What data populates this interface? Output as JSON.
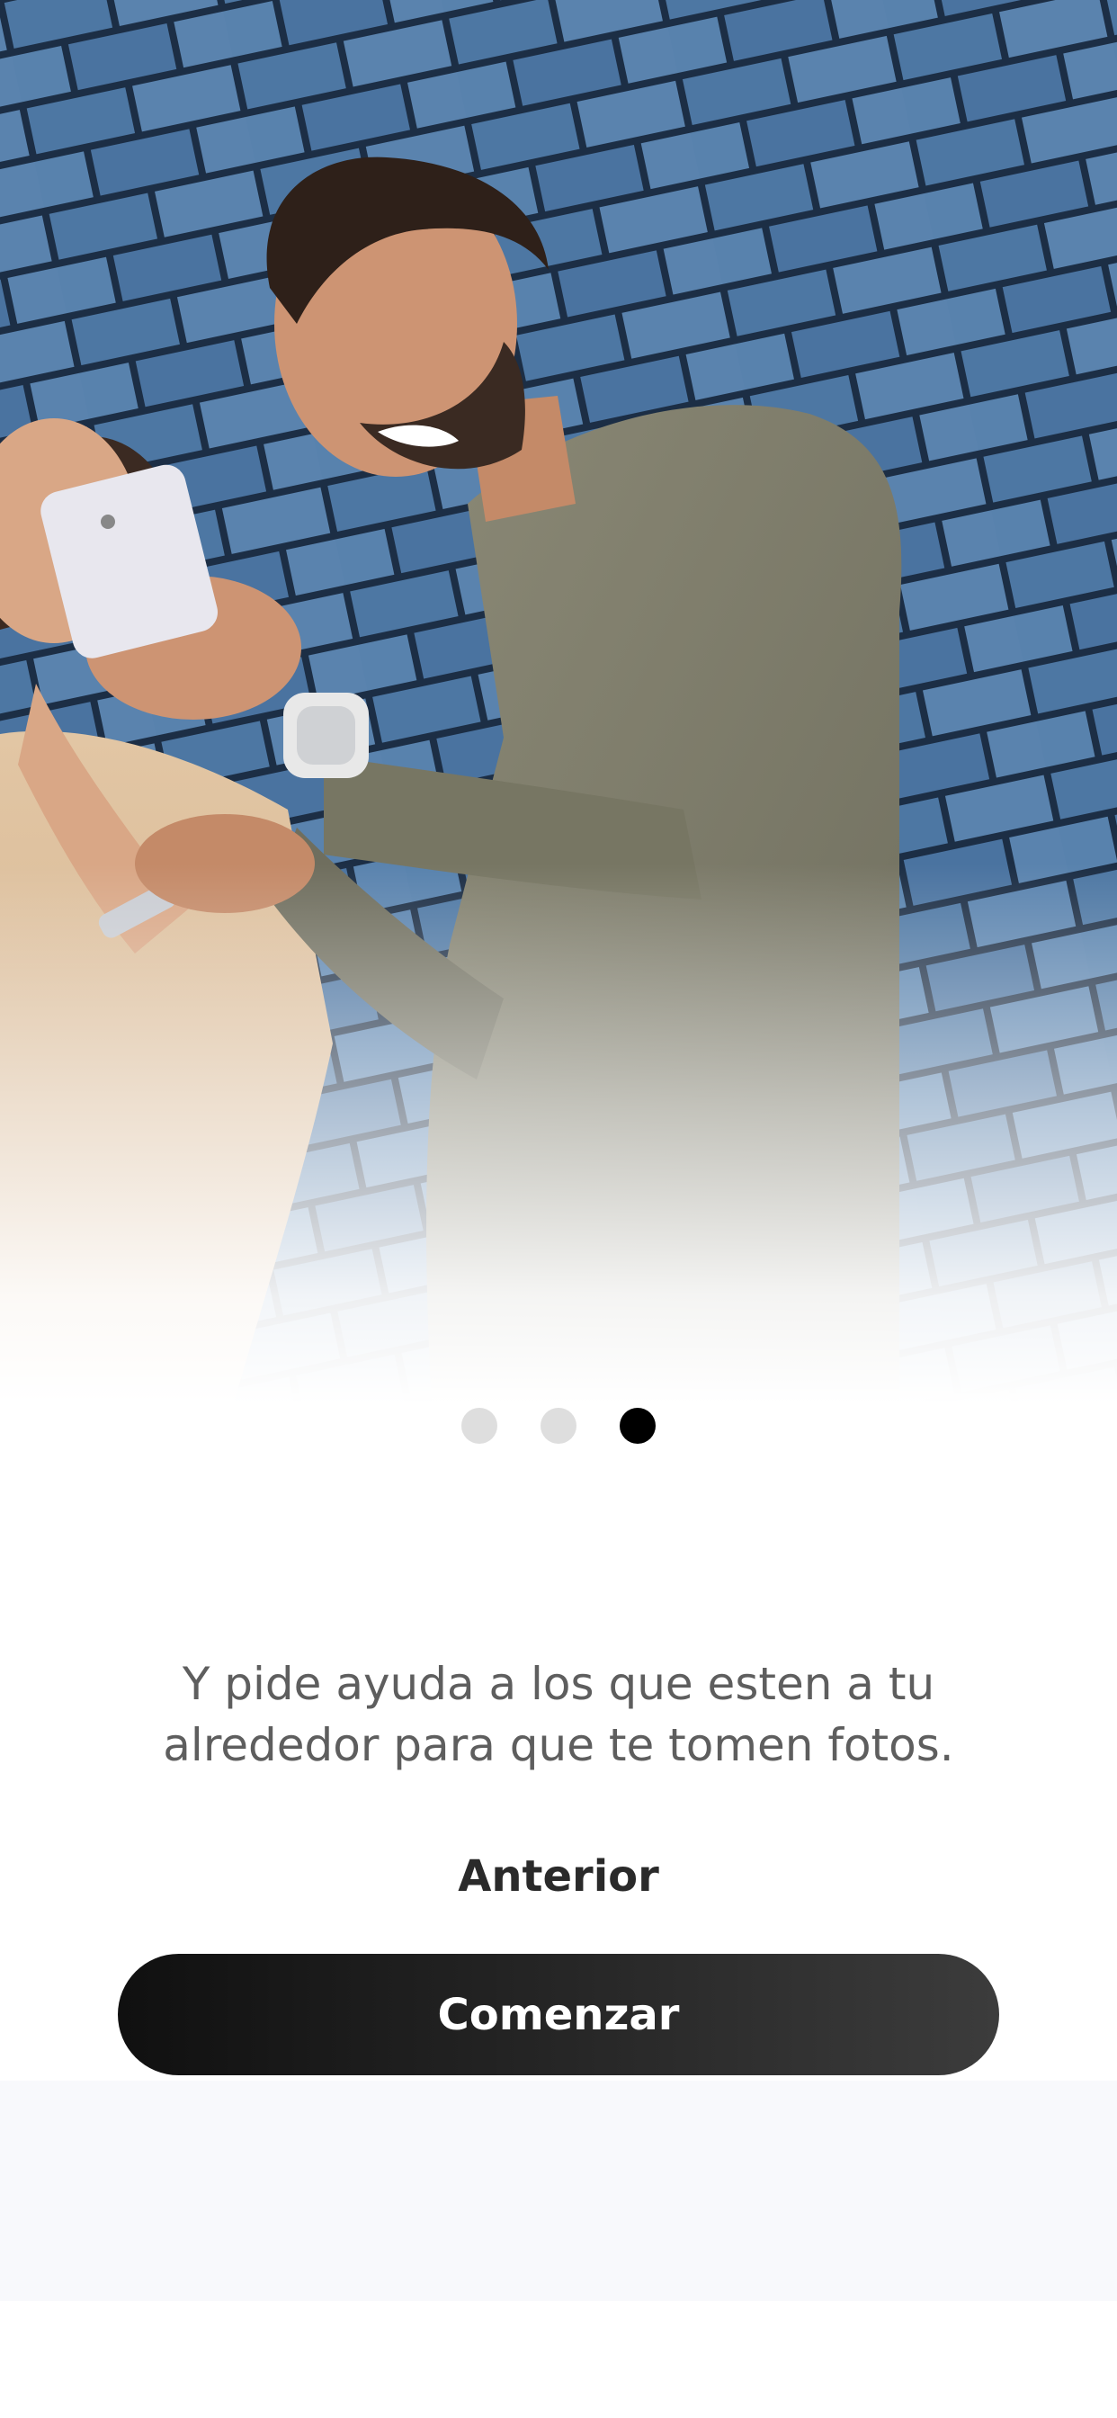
{
  "hero": {
    "image": "photo-two-friends-looking-at-phone-brick-wall",
    "wall_color": "#4d77a3",
    "mortar_color": "#1c2e45"
  },
  "pager": {
    "count": 3,
    "active_index": 2
  },
  "message": {
    "line1": "Y pide ayuda a los que esten a tu",
    "line2": "alrededor para que te tomen fotos."
  },
  "actions": {
    "previous_label": "Anterior",
    "start_label": "Comenzar"
  },
  "colors": {
    "button": "#1a1a1a",
    "dot_active": "#000000",
    "dot_inactive": "#dedede",
    "bottom_band": "#f8f9fc"
  }
}
